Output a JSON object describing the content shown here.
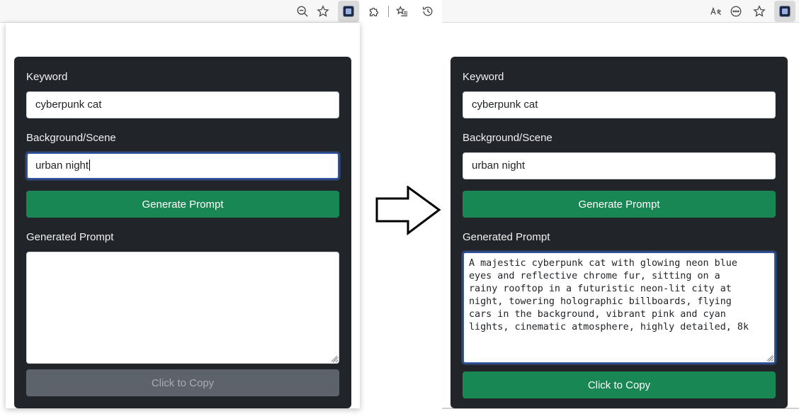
{
  "left_panel": {
    "keyword_label": "Keyword",
    "keyword_value": "cyberpunk cat",
    "scene_label": "Background/Scene",
    "scene_value": "urban night",
    "generate_label": "Generate Prompt",
    "output_label": "Generated Prompt",
    "output_value": "",
    "copy_label": "Click to Copy"
  },
  "right_panel": {
    "keyword_label": "Keyword",
    "keyword_value": "cyberpunk cat",
    "scene_label": "Background/Scene",
    "scene_value": "urban night",
    "generate_label": "Generate Prompt",
    "output_label": "Generated Prompt",
    "output_value": "A majestic cyberpunk cat with glowing neon blue eyes and reflective chrome fur, sitting on a rainy rooftop in a futuristic neon-lit city at night, towering holographic billboards, flying cars in the background, vibrant pink and cyan lights, cinematic atmosphere, highly detailed, 8k",
    "copy_label": "Click to Copy"
  },
  "toolbar_icons": {
    "left": [
      "zoom-out-icon",
      "favorite-star-icon",
      "extension-badge-icon"
    ],
    "middle": [
      "extensions-puzzle-icon",
      "favorites-list-icon",
      "history-icon"
    ],
    "right": [
      "read-aloud-icon",
      "more-options-icon",
      "favorite-star-icon",
      "extension-badge-icon"
    ]
  },
  "colors": {
    "card_bg": "#212529",
    "primary_green": "#198754",
    "disabled_grey": "#5c636a",
    "focus_blue": "#2f55a4"
  }
}
